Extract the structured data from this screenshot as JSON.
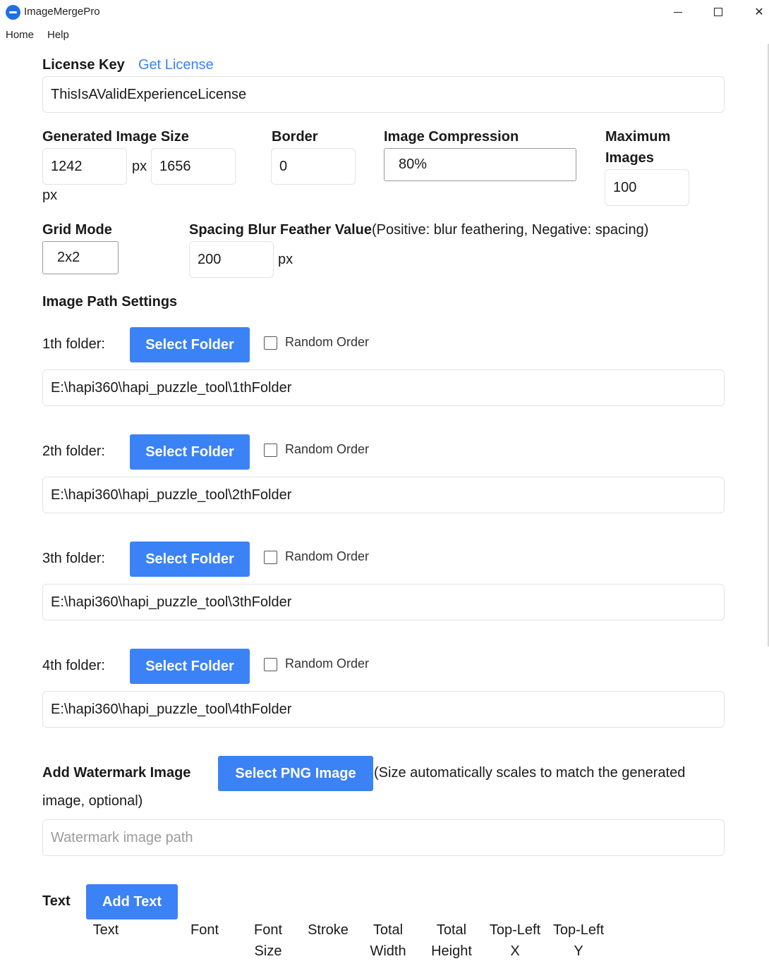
{
  "window": {
    "title": "ImageMergePro",
    "controls": {
      "minimize": "minimize",
      "maximize": "maximize",
      "close": "✕"
    }
  },
  "menu": {
    "home": "Home",
    "help": "Help"
  },
  "license": {
    "label": "License Key",
    "get_link": "Get License",
    "value": "ThisIsAValidExperienceLicense"
  },
  "size": {
    "label": "Generated Image Size",
    "width": "1242",
    "height": "1656",
    "unit": "px"
  },
  "border": {
    "label": "Border",
    "value": "0"
  },
  "compression": {
    "label": "Image Compression",
    "value": "80%"
  },
  "max_images": {
    "label_line1": "Maximum",
    "label_line2": "Images",
    "value": "100"
  },
  "grid": {
    "label": "Grid Mode",
    "value": "2x2"
  },
  "spacing": {
    "label": "Spacing Blur Feather Value",
    "hint": "(Positive: blur feathering, Negative: spacing)",
    "value": "200",
    "unit": "px"
  },
  "paths": {
    "heading": "Image Path Settings",
    "select_label": "Select Folder",
    "random_label": "Random Order",
    "folders": [
      {
        "label": "1th folder:",
        "path": "E:\\hapi360\\hapi_puzzle_tool\\1thFolder",
        "random": false
      },
      {
        "label": "2th folder:",
        "path": "E:\\hapi360\\hapi_puzzle_tool\\2thFolder",
        "random": false
      },
      {
        "label": "3th folder:",
        "path": "E:\\hapi360\\hapi_puzzle_tool\\3thFolder",
        "random": false
      },
      {
        "label": "4th folder:",
        "path": "E:\\hapi360\\hapi_puzzle_tool\\4thFolder",
        "random": false
      }
    ]
  },
  "watermark": {
    "label": "Add Watermark Image",
    "button": "Select PNG Image",
    "hint_line1": "(Size automatically scales to match the generated",
    "hint_line2": "image, optional)",
    "placeholder": "Watermark image path"
  },
  "text_section": {
    "label": "Text",
    "add_button": "Add Text",
    "columns": [
      {
        "line1": "Text",
        "line2": ""
      },
      {
        "line1": "Font",
        "line2": ""
      },
      {
        "line1": "Font",
        "line2": "Size"
      },
      {
        "line1": "Stroke",
        "line2": ""
      },
      {
        "line1": "Total",
        "line2": "Width"
      },
      {
        "line1": "Total",
        "line2": "Height"
      },
      {
        "line1": "Top-Left",
        "line2": "X"
      },
      {
        "line1": "Top-Left",
        "line2": "Y"
      }
    ]
  },
  "colors": {
    "accent": "#3b82f6",
    "logo": "#1e6fe8"
  }
}
